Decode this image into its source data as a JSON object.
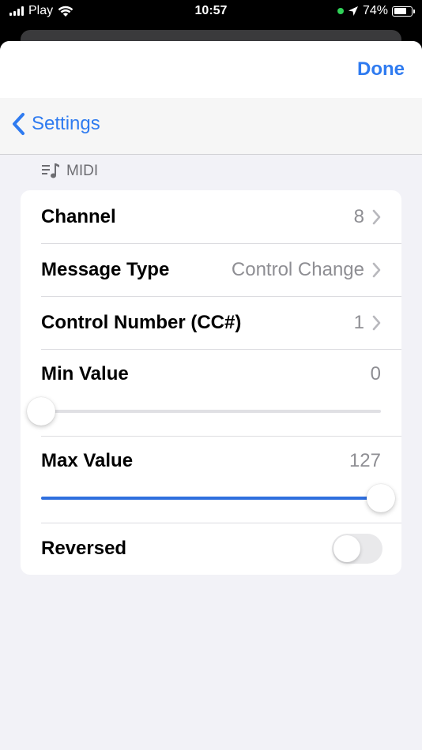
{
  "status_bar": {
    "carrier": "Play",
    "time": "10:57",
    "battery_percent": "74%",
    "battery_level": 0.74
  },
  "sheet": {
    "done_label": "Done",
    "back_label": "Settings"
  },
  "section": {
    "title": "MIDI",
    "icon": "music-list-icon"
  },
  "rows": {
    "channel": {
      "label": "Channel",
      "value": "8"
    },
    "message_type": {
      "label": "Message Type",
      "value": "Control Change"
    },
    "control_number": {
      "label": "Control Number (CC#)",
      "value": "1"
    },
    "min_value": {
      "label": "Min Value",
      "value": "0",
      "fraction": 0
    },
    "max_value": {
      "label": "Max Value",
      "value": "127",
      "fraction": 1
    },
    "reversed": {
      "label": "Reversed",
      "on": false
    }
  },
  "colors": {
    "accent": "#2f7bf0",
    "slider_fill": "#2f6fde",
    "secondary_text": "#8e8e93",
    "background": "#f2f2f7"
  }
}
